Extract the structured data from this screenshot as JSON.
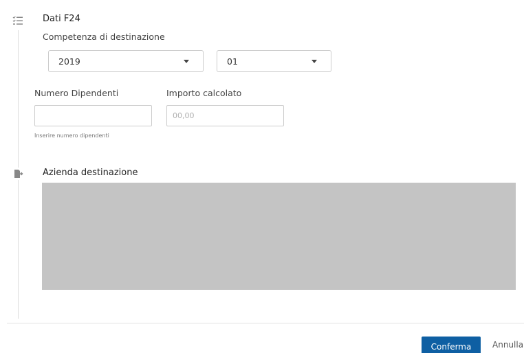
{
  "dati_f24": {
    "title": "Dati F24",
    "icon": "list-check-icon",
    "competenza_label": "Competenza di destinazione",
    "year_select": {
      "value": "2019"
    },
    "month_select": {
      "value": "01"
    },
    "numero_dipendenti": {
      "label": "Numero Dipendenti",
      "value": "",
      "hint": "Inserire numero dipendenti"
    },
    "importo_calcolato": {
      "label": "Importo calcolato",
      "placeholder": "00,00"
    }
  },
  "azienda_destinazione": {
    "title": "Azienda destinazione",
    "icon": "document-export-icon"
  },
  "actions": {
    "confirm_label": "Conferma",
    "cancel_label": "Annulla",
    "confirm_color": "#0e5fa3"
  }
}
